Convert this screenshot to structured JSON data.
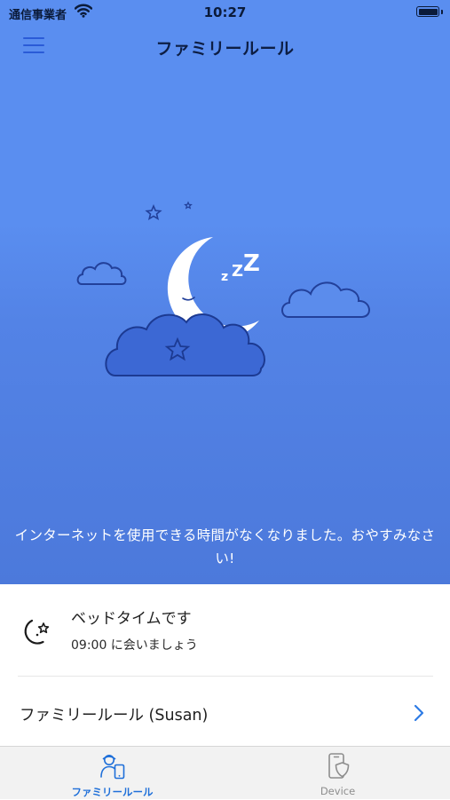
{
  "status_bar": {
    "carrier": "通信事業者",
    "time": "10:27"
  },
  "header": {
    "title": "ファミリールール",
    "menu_icon": "hamburger-menu-icon"
  },
  "hero": {
    "illustration": "sleeping-moon-clouds-stars",
    "message": "インターネットを使用できる時間がなくなりました。おやすみなさい!"
  },
  "bedtime": {
    "icon": "moon-star-icon",
    "title": "ベッドタイムです",
    "subtitle": "09:00 に会いましょう"
  },
  "rules_link": {
    "label": "ファミリールール (Susan)",
    "icon": "chevron-right-icon"
  },
  "tabs": [
    {
      "label": "ファミリールール",
      "icon": "family-rules-icon",
      "active": true
    },
    {
      "label": "Device",
      "icon": "device-shield-icon",
      "active": false
    }
  ],
  "colors": {
    "hero_top": "#5a8ef0",
    "hero_bottom": "#4c79db",
    "accent": "#1e6fd9",
    "inactive_tab": "#8d8d8d"
  }
}
